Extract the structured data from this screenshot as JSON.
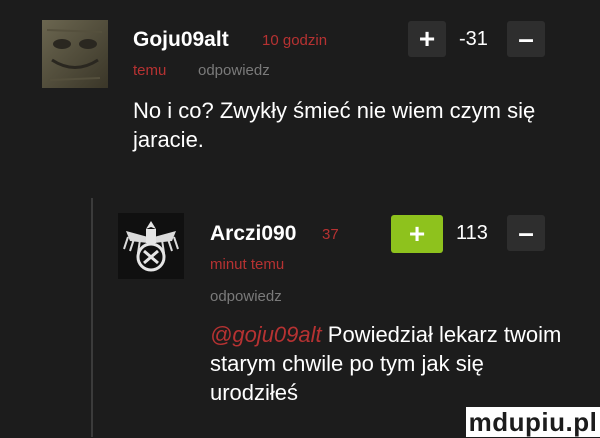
{
  "comment1": {
    "username": "Goju09alt",
    "time_label": "10 godzin",
    "time_label2": "temu",
    "reply_label": "odpowiedz",
    "score": "-31",
    "plus_label": "+",
    "minus_label": "–",
    "text": "No i co? Zwykły śmieć nie wiem czym się jaracie."
  },
  "comment2": {
    "username": "Arczi090",
    "time_label": "37",
    "time_label2": "minut temu",
    "reply_label": "odpowiedz",
    "score": "113",
    "plus_label": "+",
    "minus_label": "–",
    "mention": "@goju09alt",
    "text": "Powiedział lekarz twoim starym chwile po tym jak się urodziłeś"
  },
  "watermark": "mdupiu.pl",
  "colors": {
    "background": "#1c1c1c",
    "accent_red": "#b63232",
    "vote_green": "#8ec21d"
  }
}
